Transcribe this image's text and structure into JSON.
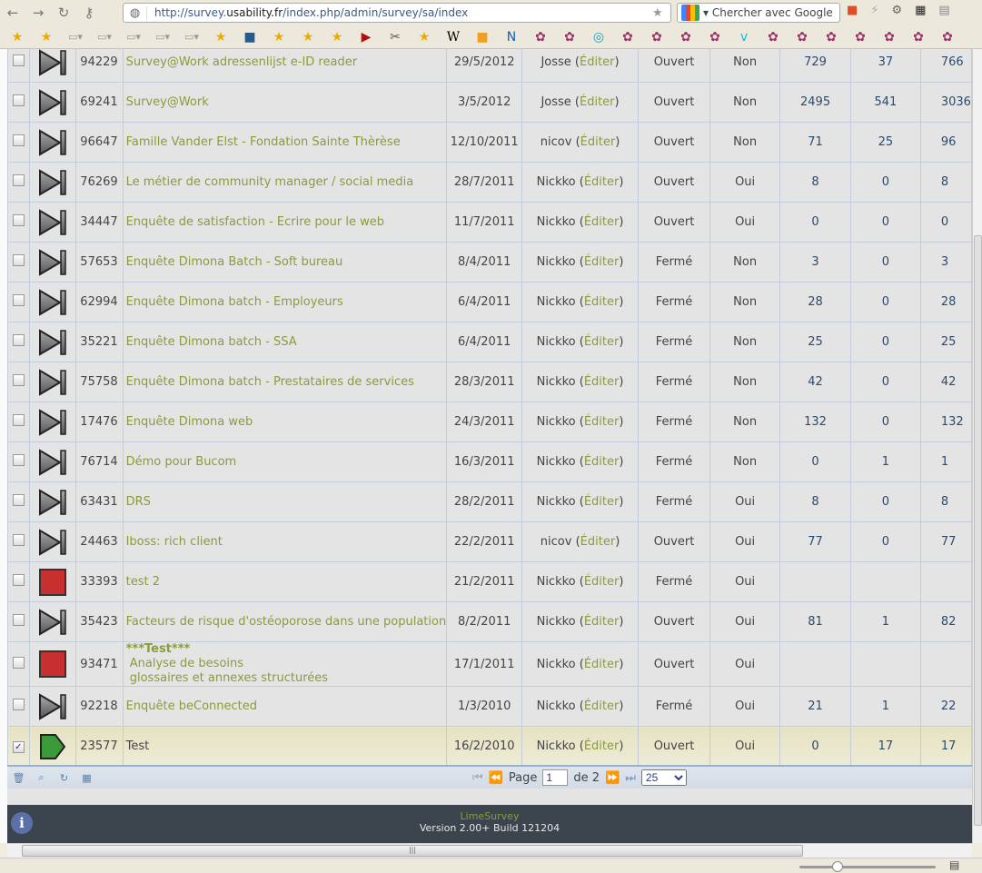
{
  "browser": {
    "url_prefix": "http://survey.",
    "url_domain": "usability.fr",
    "url_path": "/index.php/admin/survey/sa/index",
    "search_placeholder": "Chercher avec Google"
  },
  "rows": [
    {
      "id": "94229",
      "title": "Survey@Work adressenlijst e-ID reader",
      "date": "29/5/2012",
      "owner": "Josse",
      "edit": "Éditer",
      "status": "Ouvert",
      "anon": "Non",
      "c1": "729",
      "c2": "37",
      "c3": "766",
      "icon": "stop-next",
      "checked": false
    },
    {
      "id": "69241",
      "title": "Survey@Work",
      "date": "3/5/2012",
      "owner": "Josse",
      "edit": "Éditer",
      "status": "Ouvert",
      "anon": "Non",
      "c1": "2495",
      "c2": "541",
      "c3": "3036",
      "icon": "stop-next",
      "checked": false
    },
    {
      "id": "96647",
      "title": "Famille Vander Elst - Fondation Sainte Thèrèse",
      "date": "12/10/2011",
      "owner": "nicov",
      "edit": "Éditer",
      "status": "Ouvert",
      "anon": "Non",
      "c1": "71",
      "c2": "25",
      "c3": "96",
      "icon": "stop-next",
      "checked": false
    },
    {
      "id": "76269",
      "title": "Le métier de community manager / social media",
      "date": "28/7/2011",
      "owner": "Nickko",
      "edit": "Éditer",
      "status": "Ouvert",
      "anon": "Oui",
      "c1": "8",
      "c2": "0",
      "c3": "8",
      "icon": "stop-next",
      "checked": false
    },
    {
      "id": "34447",
      "title": "Enquête de satisfaction - Ecrire pour le web",
      "date": "11/7/2011",
      "owner": "Nickko",
      "edit": "Éditer",
      "status": "Ouvert",
      "anon": "Oui",
      "c1": "0",
      "c2": "0",
      "c3": "0",
      "icon": "stop-next",
      "checked": false
    },
    {
      "id": "57653",
      "title": "Enquête Dimona Batch - Soft bureau",
      "date": "8/4/2011",
      "owner": "Nickko",
      "edit": "Éditer",
      "status": "Fermé",
      "anon": "Non",
      "c1": "3",
      "c2": "0",
      "c3": "3",
      "icon": "stop-next",
      "checked": false
    },
    {
      "id": "62994",
      "title": "Enquête Dimona batch - Employeurs",
      "date": "6/4/2011",
      "owner": "Nickko",
      "edit": "Éditer",
      "status": "Fermé",
      "anon": "Non",
      "c1": "28",
      "c2": "0",
      "c3": "28",
      "icon": "stop-next",
      "checked": false
    },
    {
      "id": "35221",
      "title": "Enquête Dimona batch - SSA",
      "date": "6/4/2011",
      "owner": "Nickko",
      "edit": "Éditer",
      "status": "Fermé",
      "anon": "Non",
      "c1": "25",
      "c2": "0",
      "c3": "25",
      "icon": "stop-next",
      "checked": false
    },
    {
      "id": "75758",
      "title": "Enquête Dimona batch - Prestataires de services",
      "date": "28/3/2011",
      "owner": "Nickko",
      "edit": "Éditer",
      "status": "Fermé",
      "anon": "Non",
      "c1": "42",
      "c2": "0",
      "c3": "42",
      "icon": "stop-next",
      "checked": false
    },
    {
      "id": "17476",
      "title": "Enquête Dimona web",
      "date": "24/3/2011",
      "owner": "Nickko",
      "edit": "Éditer",
      "status": "Fermé",
      "anon": "Non",
      "c1": "132",
      "c2": "0",
      "c3": "132",
      "icon": "stop-next",
      "checked": false
    },
    {
      "id": "76714",
      "title": "Démo pour Bucom",
      "date": "16/3/2011",
      "owner": "Nickko",
      "edit": "Éditer",
      "status": "Fermé",
      "anon": "Non",
      "c1": "0",
      "c2": "1",
      "c3": "1",
      "icon": "stop-next",
      "checked": false
    },
    {
      "id": "63431",
      "title": "DRS",
      "date": "28/2/2011",
      "owner": "Nickko",
      "edit": "Éditer",
      "status": "Fermé",
      "anon": "Oui",
      "c1": "8",
      "c2": "0",
      "c3": "8",
      "icon": "stop-next",
      "checked": false
    },
    {
      "id": "24463",
      "title": "Iboss: rich client",
      "date": "22/2/2011",
      "owner": "nicov",
      "edit": "Éditer",
      "status": "Ouvert",
      "anon": "Oui",
      "c1": "77",
      "c2": "0",
      "c3": "77",
      "icon": "stop-next",
      "checked": false
    },
    {
      "id": "33393",
      "title": "test 2",
      "date": "21/2/2011",
      "owner": "Nickko",
      "edit": "Éditer",
      "status": "Fermé",
      "anon": "Oui",
      "c1": "",
      "c2": "",
      "c3": "",
      "icon": "stop",
      "checked": false
    },
    {
      "id": "35423",
      "title": "Facteurs de risque d'ostéoporose dans une population",
      "date": "8/2/2011",
      "owner": "Nickko",
      "edit": "Éditer",
      "status": "Ouvert",
      "anon": "Oui",
      "c1": "81",
      "c2": "1",
      "c3": "82",
      "icon": "stop-next",
      "checked": false
    },
    {
      "id": "93471",
      "title": "***Test***",
      "subtitle1": "Analyse de besoins",
      "subtitle2": "glossaires et annexes structurées",
      "date": "17/1/2011",
      "owner": "Nickko",
      "edit": "Éditer",
      "status": "Ouvert",
      "anon": "Oui",
      "c1": "",
      "c2": "",
      "c3": "",
      "icon": "stop",
      "checked": false
    },
    {
      "id": "92218",
      "title": "Enquête beConnected",
      "date": "1/3/2010",
      "owner": "Nickko",
      "edit": "Éditer",
      "status": "Fermé",
      "anon": "Oui",
      "c1": "21",
      "c2": "1",
      "c3": "22",
      "icon": "stop-next",
      "checked": false
    },
    {
      "id": "23577",
      "title": "Test",
      "date": "16/2/2010",
      "owner": "Nickko",
      "edit": "Éditer",
      "status": "Ouvert",
      "anon": "Oui",
      "c1": "0",
      "c2": "17",
      "c3": "17",
      "icon": "play",
      "checked": true
    }
  ],
  "pager": {
    "page_label": "Page",
    "page_value": "1",
    "of_label": "de 2",
    "page_size": "25"
  },
  "footer": {
    "product": "LimeSurvey",
    "version": "Version 2.00+ Build 121204"
  },
  "colors": {
    "link": "#8a9c3a",
    "selected_row": "#e6e2c2",
    "footer_bg": "#3c444e"
  }
}
